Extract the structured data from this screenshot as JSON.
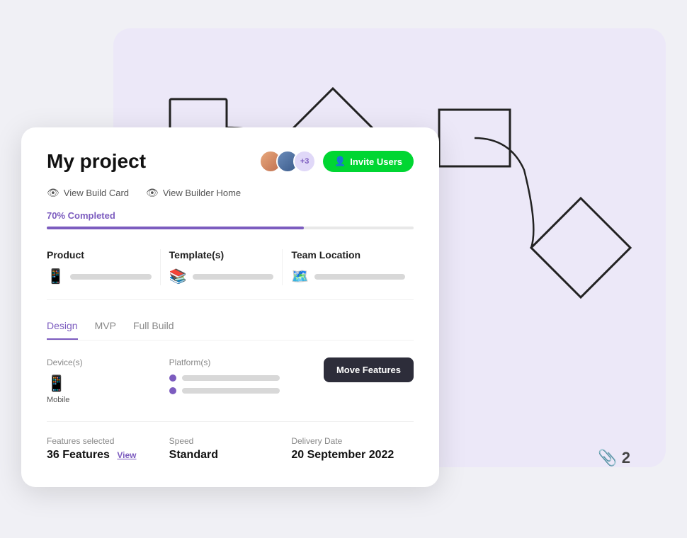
{
  "bg_card": {
    "aria_label": "flowchart background"
  },
  "attachment": {
    "icon": "📎",
    "count": "2"
  },
  "project_card": {
    "title": "My project",
    "invite_button": "Invite Users",
    "nav": {
      "view_build_card": "View Build Card",
      "view_builder_home": "View Builder Home"
    },
    "progress": {
      "label": "70% Completed",
      "value": 70
    },
    "info_items": [
      {
        "label": "Product",
        "icon": "📱"
      },
      {
        "label": "Template(s)",
        "icon": "📚"
      },
      {
        "label": "Team Location",
        "icon": "🗺️"
      }
    ],
    "tabs": [
      {
        "label": "Design",
        "active": true
      },
      {
        "label": "MVP",
        "active": false
      },
      {
        "label": "Full Build",
        "active": false
      }
    ],
    "design": {
      "devices_label": "Device(s)",
      "device_name": "Mobile",
      "platforms_label": "Platform(s)",
      "move_button": "Move Features"
    },
    "bottom": [
      {
        "label": "Features selected",
        "value": "36 Features",
        "extra": "View"
      },
      {
        "label": "Speed",
        "value": "Standard",
        "extra": ""
      },
      {
        "label": "Delivery Date",
        "value": "20 September 2022",
        "extra": ""
      }
    ]
  }
}
